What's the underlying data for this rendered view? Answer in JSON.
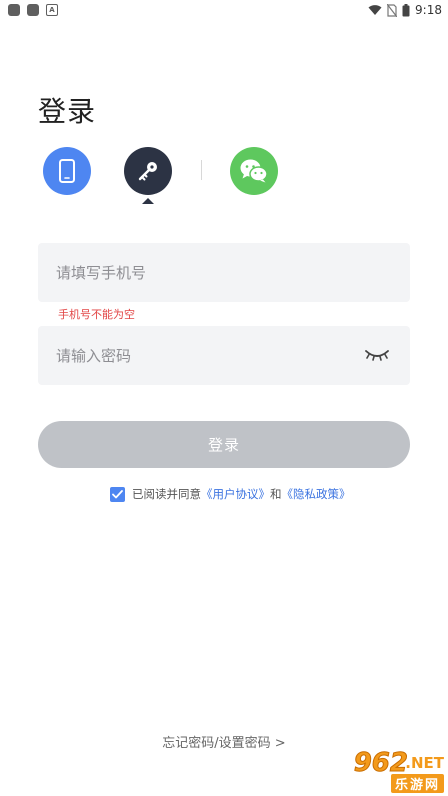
{
  "status_bar": {
    "notification_icon_label": "A",
    "time": "9:18"
  },
  "page": {
    "title": "登录"
  },
  "login_methods": [
    {
      "name": "phone",
      "icon": "phone-icon",
      "color": "#4e86f1"
    },
    {
      "name": "password",
      "icon": "key-icon",
      "color": "#2c3344",
      "selected": true
    },
    {
      "name": "wechat",
      "icon": "wechat-icon",
      "color": "#5ec85e"
    }
  ],
  "form": {
    "phone_placeholder": "请填写手机号",
    "phone_value": "",
    "phone_error": "手机号不能为空",
    "password_placeholder": "请输入密码",
    "password_value": "",
    "login_button": "登录"
  },
  "agreement": {
    "checked": true,
    "prefix": "已阅读并同意",
    "user_agreement": "《用户协议》",
    "conjunction": "和",
    "privacy_policy": "《隐私政策》"
  },
  "footer": {
    "forgot_password": "忘记密码/设置密码 >"
  },
  "watermark": {
    "number": "962",
    "suffix": ".NET",
    "chinese": "乐游网"
  },
  "colors": {
    "accent_blue": "#4e86f1",
    "dark": "#2c3344",
    "wechat_green": "#5ec85e",
    "error_red": "#e24545",
    "disabled_button": "#bfc2c7"
  }
}
